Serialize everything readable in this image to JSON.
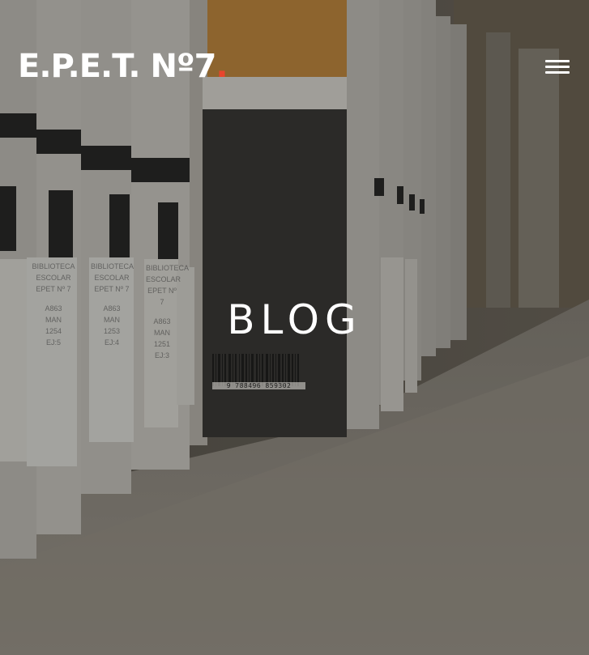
{
  "header": {
    "brand_text": "E.P.E.T. Nº7",
    "brand_dot": ".",
    "brand_dot_color": "#e8452c",
    "menu_icon": "hamburger-menu-icon"
  },
  "hero": {
    "title": "BLOG",
    "background": "bookshelf-photo",
    "book_labels": [
      {
        "lines": [
          "BIBLIOTECA",
          "ESCOLAR",
          "EPET Nº 7",
          "A863",
          "MAN",
          "1254",
          "EJ:5"
        ]
      },
      {
        "lines": [
          "BIBLIOTECA",
          "ESCOLAR",
          "EPET Nº 7",
          "A863",
          "MAN",
          "1253",
          "EJ:4"
        ]
      },
      {
        "lines": [
          "BIBLIOTECA",
          "ESCOLAR",
          "EPET Nº 7",
          "A863",
          "MAN",
          "1251",
          "EJ:3"
        ]
      }
    ],
    "barcode_number": "9 788496 859302"
  }
}
